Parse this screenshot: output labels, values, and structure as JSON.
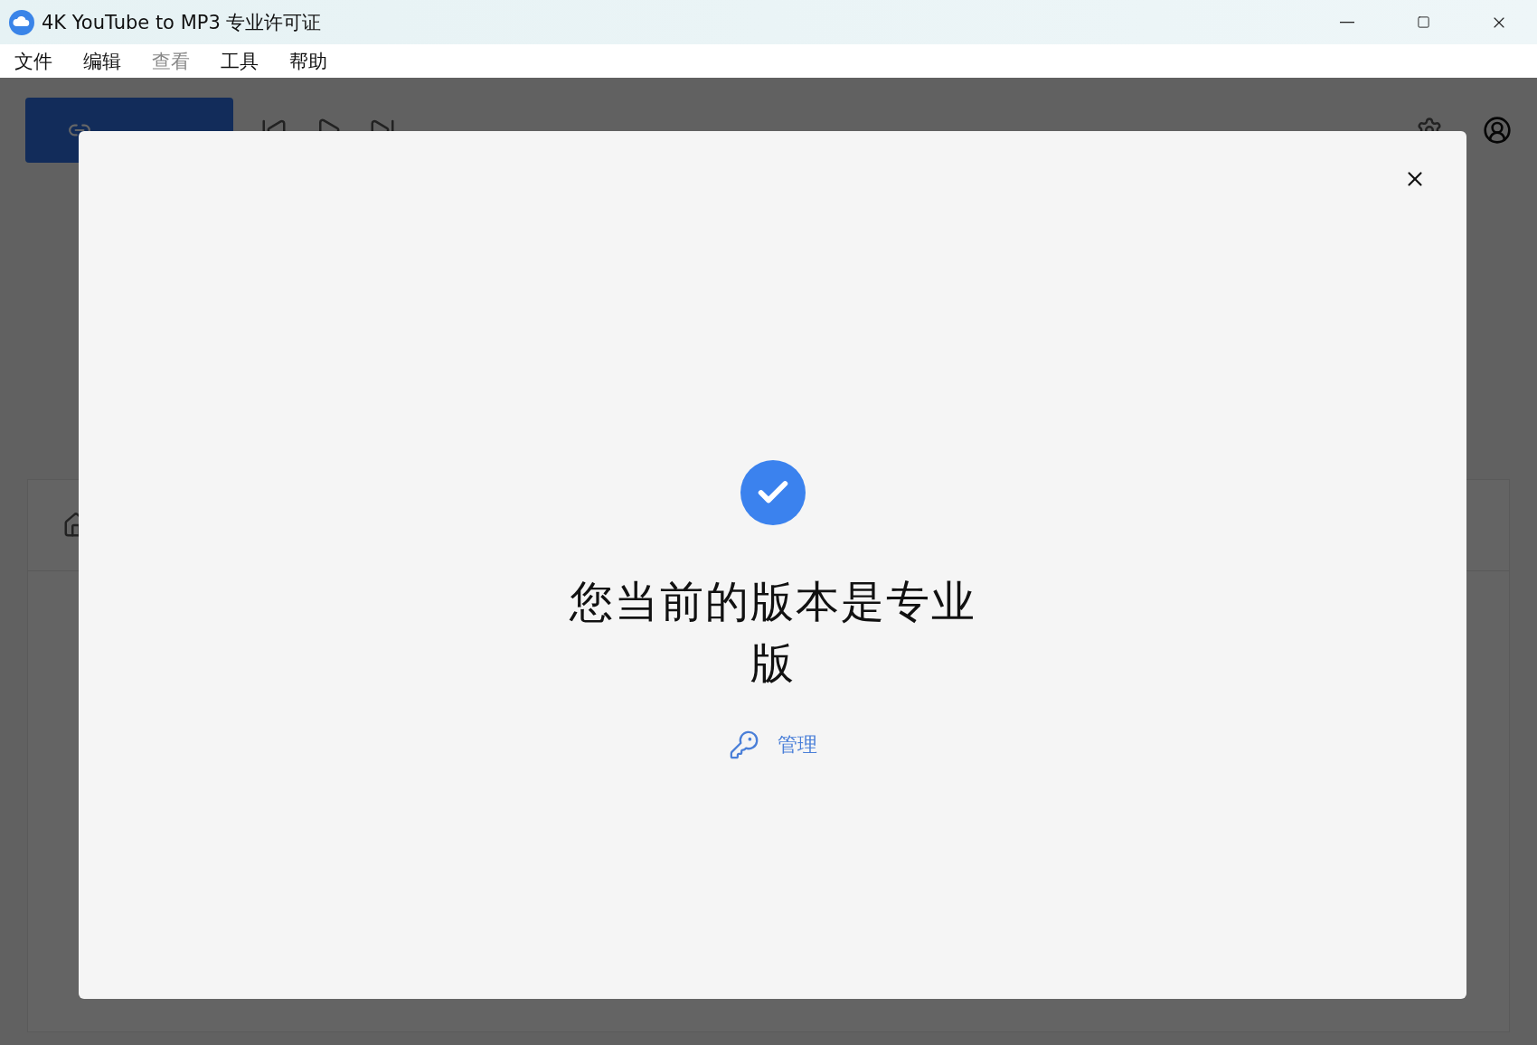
{
  "window": {
    "title": "4K YouTube to MP3 专业许可证"
  },
  "menu": [
    {
      "label": "文件",
      "disabled": false
    },
    {
      "label": "编辑",
      "disabled": false
    },
    {
      "label": "查看",
      "disabled": true
    },
    {
      "label": "工具",
      "disabled": false
    },
    {
      "label": "帮助",
      "disabled": false
    }
  ],
  "dialog": {
    "heading": "您当前的版本是专业版",
    "manage_link": "管理"
  }
}
